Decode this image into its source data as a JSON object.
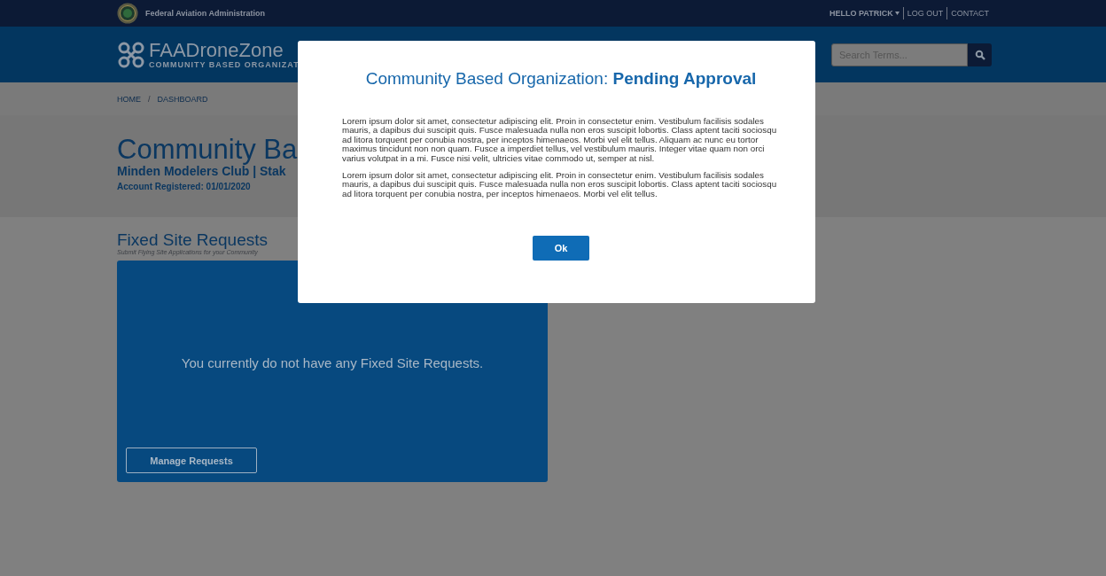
{
  "top_bar": {
    "agency": "Federal Aviation Administration",
    "user_menu": "HELLO PATRICK",
    "links": [
      "LOG OUT",
      "CONTACT"
    ]
  },
  "header": {
    "logo_title": "FAADroneZone",
    "logo_subtitle": "COMMUNITY BASED ORGANIZAT",
    "search": {
      "placeholder": "Search Terms..."
    }
  },
  "breadcrumb": {
    "items": [
      "HOME",
      "DASHBOARD"
    ],
    "separator": "/"
  },
  "account": {
    "title": "Community Ba",
    "subtitle": "Minden Modelers Club | Stak",
    "registered": "Account Registered: 01/01/2020"
  },
  "fixed_site_requests": {
    "title": "Fixed Site Requests",
    "description": "Submit Flying Site Applications for your Community",
    "empty_message": "You currently do not have any Fixed Site Requests.",
    "button": "Manage Requests"
  },
  "modal": {
    "title": "Community Based Organization: **Pending Approval**",
    "paragraphs": [
      "Lorem ipsum dolor sit amet, consectetur adipiscing elit. Proin in consectetur enim. Vestibulum facilisis sodales mauris, a dapibus dui suscipit quis. Fusce malesuada nulla non eros suscipit lobortis. Class aptent taciti sociosqu ad litora torquent per conubia nostra, per inceptos himenaeos. Morbi vel elit tellus. Aliquam ac nunc eu tortor maximus tincidunt non non quam. Fusce a imperdiet tellus, vel vestibulum mauris. Integer vitae quam non orci varius volutpat in a mi. Fusce nisi velit, ultricies vitae commodo ut, semper at nisl.",
      "Lorem ipsum dolor sit amet, consectetur adipiscing elit. Proin in consectetur enim. Vestibulum facilisis sodales mauris, a dapibus dui suscipit quis. Fusce malesuada nulla non eros suscipit lobortis. Class aptent taciti sociosqu ad litora torquent per conubia nostra, per inceptos himenaeos. Morbi vel elit tellus."
    ],
    "button": "Ok"
  }
}
